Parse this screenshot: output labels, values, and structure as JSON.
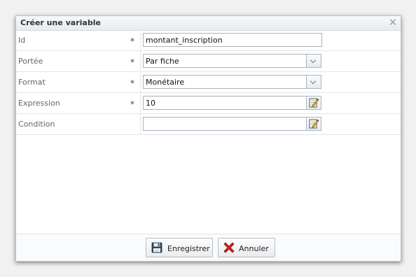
{
  "dialog": {
    "title": "Créer une variable",
    "close_icon": "close-icon"
  },
  "form": {
    "required_marker": "*",
    "rows": [
      {
        "label": "Id",
        "required": true,
        "value": "montant_inscription",
        "control": "text"
      },
      {
        "label": "Portée",
        "required": true,
        "value": "Par fiche",
        "control": "select"
      },
      {
        "label": "Format",
        "required": true,
        "value": "Monétaire",
        "control": "select"
      },
      {
        "label": "Expression",
        "required": true,
        "value": "10",
        "control": "expression"
      },
      {
        "label": "Condition",
        "required": false,
        "value": "",
        "control": "expression"
      }
    ]
  },
  "footer": {
    "save_label": "Enregistrer",
    "save_icon": "floppy-disk-icon",
    "cancel_label": "Annuler",
    "cancel_icon": "red-x-icon"
  },
  "colors": {
    "accent": "#3a6ea5",
    "cancel_red": "#d0241b",
    "border": "#a9b4be"
  }
}
